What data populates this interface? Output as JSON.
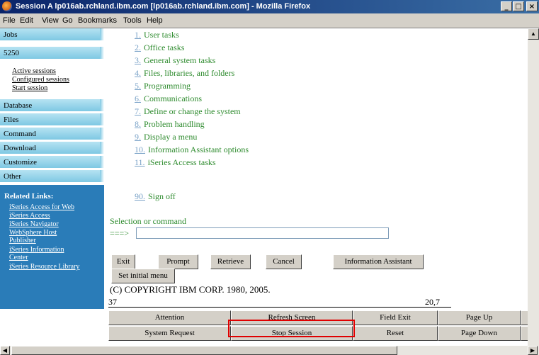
{
  "window": {
    "title": "Session A lp016ab.rchland.ibm.com [lp016ab.rchland.ibm.com] - Mozilla Firefox",
    "controls": [
      "_",
      "□",
      "×"
    ]
  },
  "menubar": [
    "File",
    "Edit",
    "View",
    "Go",
    "Bookmarks",
    "Tools",
    "Help"
  ],
  "sidebar": {
    "tabs": [
      "Jobs",
      "5250",
      "Database",
      "Files",
      "Command",
      "Download",
      "Customize",
      "Other"
    ],
    "subitems": [
      "Active sessions",
      "Configured sessions",
      "Start session"
    ],
    "related": {
      "title": "Related Links:",
      "links": [
        "iSeries Access for Web",
        "iSeries Access",
        "iSeries Navigator",
        "WebSphere Host Publisher",
        "iSeries Information Center",
        "iSeries Resource Library"
      ]
    }
  },
  "menu": [
    {
      "num": "1.",
      "label": "User tasks"
    },
    {
      "num": "2.",
      "label": "Office tasks"
    },
    {
      "num": "3.",
      "label": "General system tasks"
    },
    {
      "num": "4.",
      "label": "Files, libraries, and folders"
    },
    {
      "num": "5.",
      "label": "Programming"
    },
    {
      "num": "6.",
      "label": "Communications"
    },
    {
      "num": "7.",
      "label": "Define or change the system"
    },
    {
      "num": "8.",
      "label": "Problem handling"
    },
    {
      "num": "9.",
      "label": "Display a menu"
    },
    {
      "num": "10.",
      "label": "Information Assistant options"
    },
    {
      "num": "11.",
      "label": "iSeries Access tasks"
    },
    {
      "num": "90.",
      "label": "Sign off"
    }
  ],
  "selection": {
    "label": "Selection or command",
    "arrow": "===>",
    "value": ""
  },
  "function_buttons": [
    "Exit",
    "Prompt",
    "Retrieve",
    "Cancel",
    "Information Assistant",
    "Set initial menu"
  ],
  "copyright": "(C) COPYRIGHT IBM CORP. 1980, 2005.",
  "status": {
    "left": "37",
    "right": "20,7"
  },
  "keys_row1": [
    "Attention",
    "Refresh Screen",
    "Field Exit",
    "Page Up"
  ],
  "keys_row2": [
    "System Request",
    "Stop Session",
    "Reset",
    "Page Down"
  ]
}
